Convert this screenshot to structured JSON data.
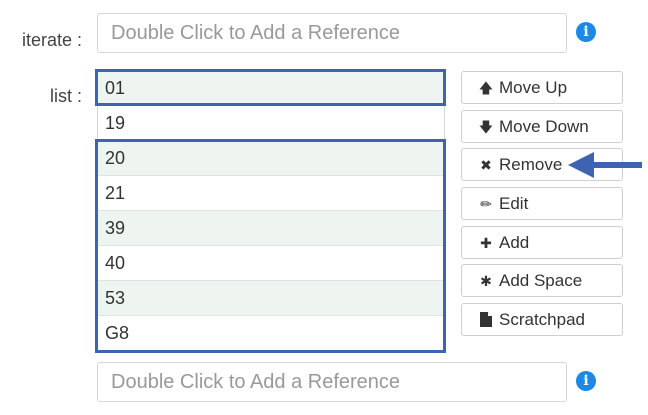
{
  "iterate": {
    "label": "iterate :",
    "placeholder": "Double Click to Add a Reference",
    "info_icon": "info-circle-icon"
  },
  "list": {
    "label": "list :",
    "items": [
      "01",
      "19",
      "20",
      "21",
      "39",
      "40",
      "53",
      "G8"
    ],
    "highlighted_items": [
      "01",
      "20",
      "21",
      "39",
      "40",
      "53",
      "G8"
    ]
  },
  "buttons": {
    "move_up": {
      "label": "Move Up",
      "icon": "arrow-up-icon"
    },
    "move_down": {
      "label": "Move Down",
      "icon": "arrow-down-icon"
    },
    "remove": {
      "label": "Remove",
      "icon": "times-icon"
    },
    "edit": {
      "label": "Edit",
      "icon": "pencil-icon"
    },
    "add": {
      "label": "Add",
      "icon": "plus-icon"
    },
    "add_space": {
      "label": "Add Space",
      "icon": "asterisk-icon"
    },
    "scratchpad": {
      "label": "Scratchpad",
      "icon": "file-icon"
    }
  },
  "bottom_reference": {
    "placeholder": "Double Click to Add a Reference",
    "info_icon": "info-circle-icon"
  },
  "colors": {
    "highlight_frame": "#3e63b0",
    "annotation_arrow": "#3e63b0",
    "selected_row": "#eef4ef",
    "info_icon": "#1e88e5"
  }
}
